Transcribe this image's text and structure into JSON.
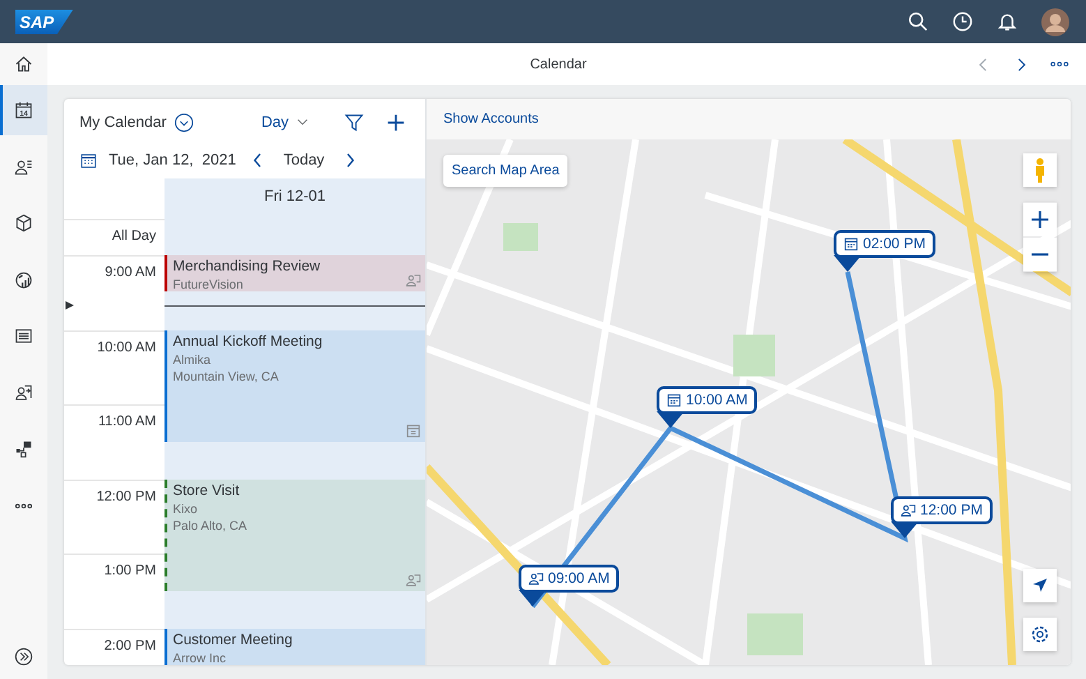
{
  "shell": {
    "logo": "SAP"
  },
  "page": {
    "title": "Calendar"
  },
  "nav": [
    {
      "kind": "calendar",
      "icon_text": "14",
      "selected": true
    },
    {
      "kind": "contacts",
      "selected": false
    },
    {
      "kind": "box",
      "selected": false
    },
    {
      "kind": "chart",
      "selected": false
    },
    {
      "kind": "list",
      "selected": false
    },
    {
      "kind": "checkin",
      "selected": false
    },
    {
      "kind": "org",
      "selected": false
    },
    {
      "kind": "more",
      "selected": false
    }
  ],
  "calendar": {
    "view_label": "My Calendar",
    "view_mode": "Day",
    "date": "Tue, Jan 12,  2021",
    "today": "Today",
    "day_header": "Fri 12-01",
    "all_day": "All Day",
    "hours": [
      "9:00 AM",
      "10:00 AM",
      "11:00 AM",
      "12:00 PM",
      "1:00 PM",
      "2:00 PM"
    ],
    "events": [
      {
        "title": "Merchandising Review",
        "lines": [
          "FutureVision"
        ],
        "color": "#bb0000",
        "tentative": false,
        "kind": "people"
      },
      {
        "title": "Annual Kickoff Meeting",
        "lines": [
          "Almika",
          "Mountain View, CA"
        ],
        "color": "#0a6ed1",
        "tentative": false,
        "kind": "calendar"
      },
      {
        "title": "Store Visit",
        "lines": [
          "Kixo",
          "Palo Alto, CA"
        ],
        "color": "#2b7d2b",
        "tentative": true,
        "kind": "people"
      },
      {
        "title": "Customer Meeting",
        "lines": [
          "Arrow Inc"
        ],
        "color": "#0a6ed1",
        "tentative": false,
        "kind": "plain"
      }
    ]
  },
  "map": {
    "link": "Show Accounts",
    "search_button": "Search Map Area",
    "pins": [
      {
        "time": "02:00 PM",
        "kind": "calendar"
      },
      {
        "time": "10:00 AM",
        "kind": "calendar"
      },
      {
        "time": "12:00 PM",
        "kind": "people"
      },
      {
        "time": "09:00 AM",
        "kind": "people"
      }
    ]
  }
}
